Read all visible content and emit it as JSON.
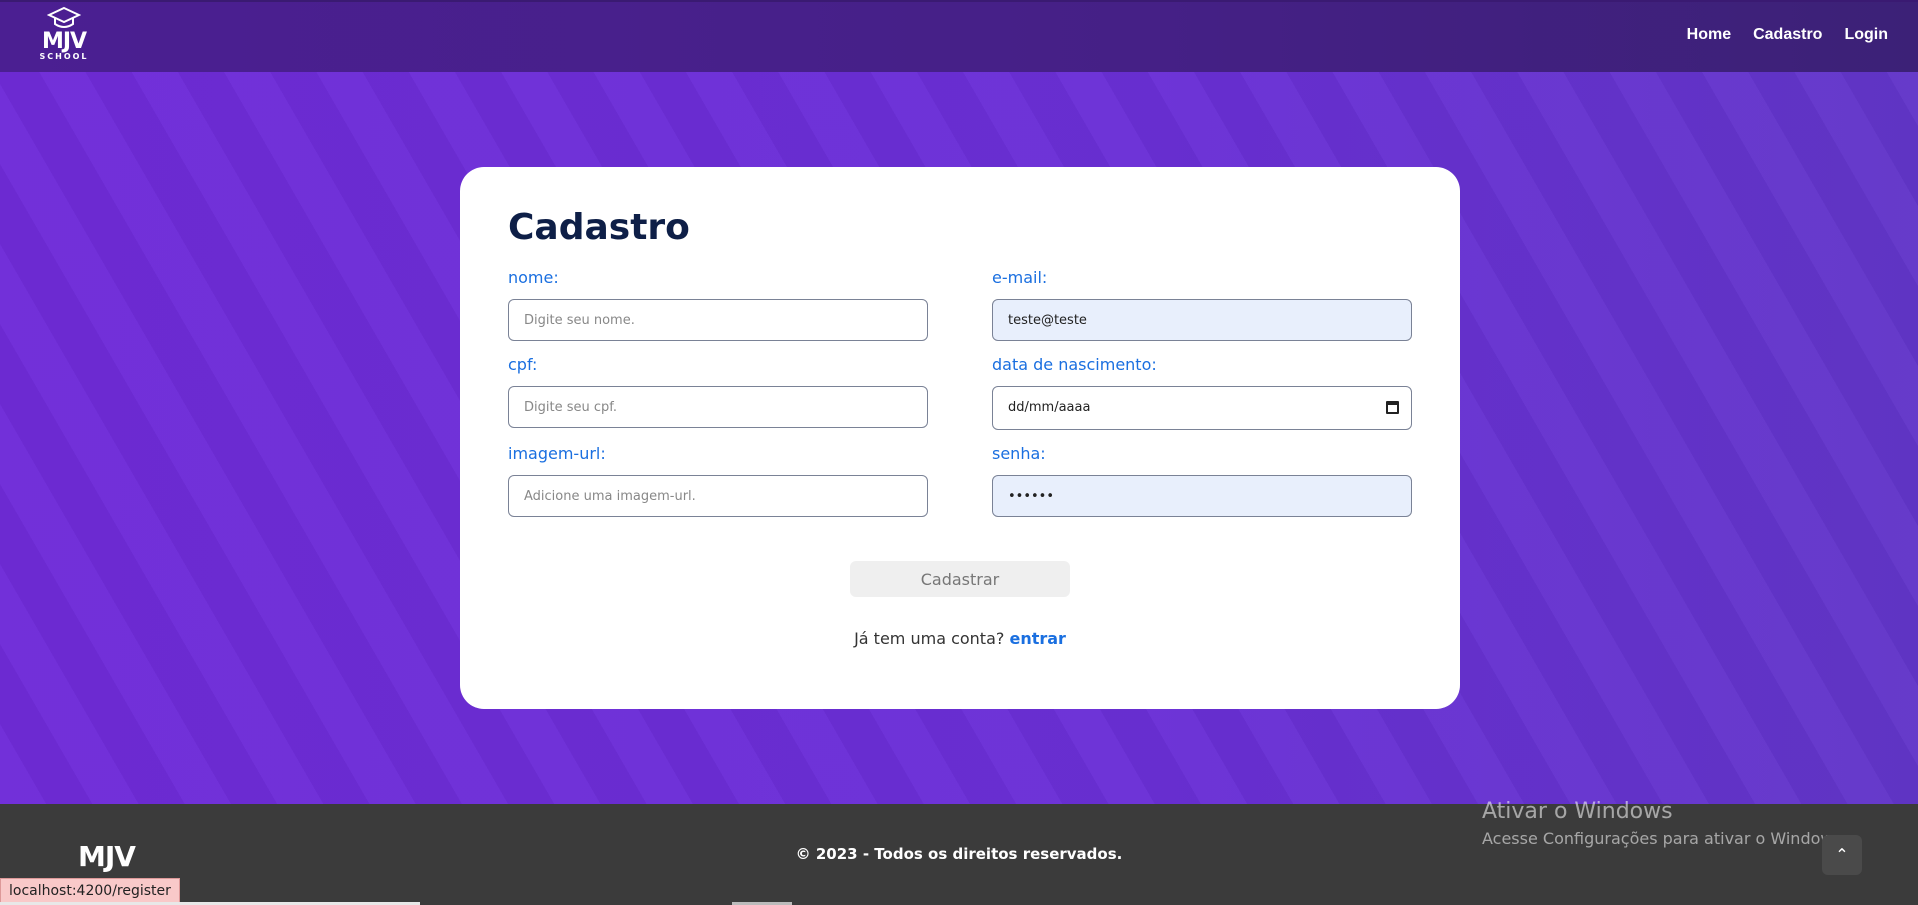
{
  "brand": {
    "name": "MJV",
    "sub": "SCHOOL"
  },
  "nav": {
    "home": "Home",
    "cadastro": "Cadastro",
    "login": "Login"
  },
  "form": {
    "title": "Cadastro",
    "nome": {
      "label": "nome:",
      "placeholder": "Digite seu nome.",
      "value": ""
    },
    "email": {
      "label": "e-mail:",
      "placeholder": "",
      "value": "teste@teste"
    },
    "cpf": {
      "label": "cpf:",
      "placeholder": "Digite seu cpf.",
      "value": ""
    },
    "nascimento": {
      "label": "data de nascimento:",
      "value": "dd/mm/aaaa"
    },
    "imagem": {
      "label": "imagem-url:",
      "placeholder": "Adicione uma imagem-url.",
      "value": ""
    },
    "senha": {
      "label": "senha:",
      "value": "••••••"
    },
    "submit": "Cadastrar",
    "login_prompt": "Já tem uma conta?",
    "login_link": "entrar"
  },
  "footer": {
    "logo": "MJV",
    "copyright": "© 2023 - Todos os direitos reservados."
  },
  "system": {
    "watermark_title": "Ativar o Windows",
    "watermark_sub": "Acesse Configurações para ativar o Windows.",
    "status_url": "localhost:4200/register"
  },
  "colors": {
    "accent": "#1a6fe0",
    "navbar": "#4b1f92",
    "background": "#6b2cd9",
    "footer": "#3b3b3b"
  }
}
